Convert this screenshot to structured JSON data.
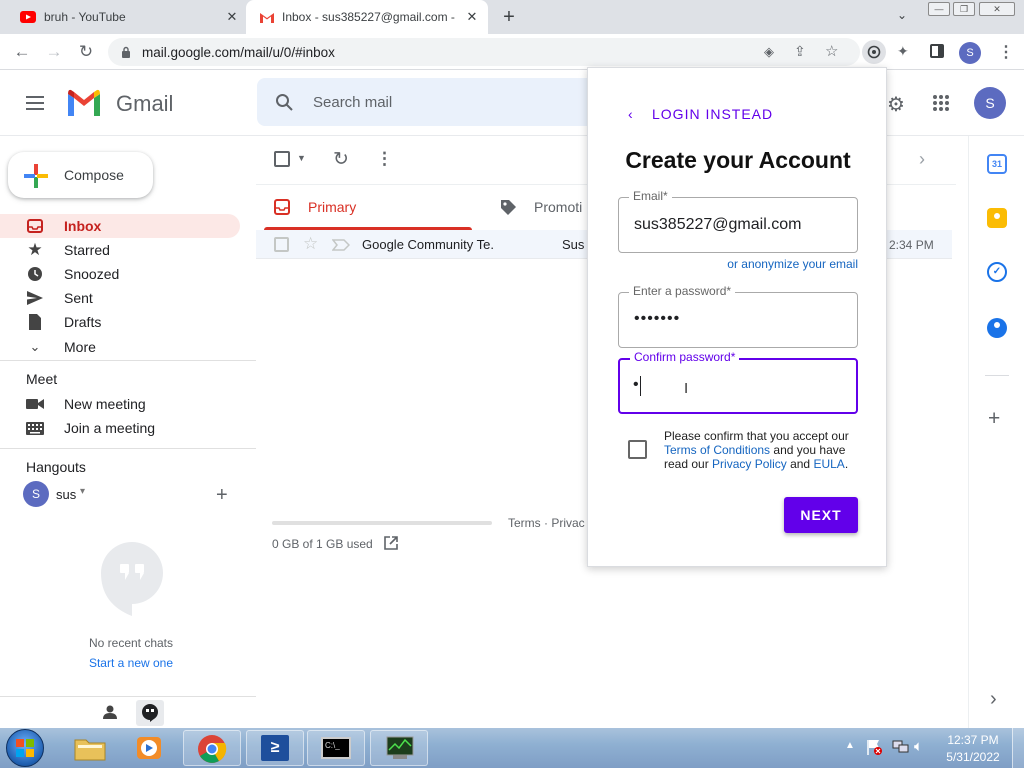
{
  "browser": {
    "tabs": [
      {
        "label": "bruh - YouTube"
      },
      {
        "label": "Inbox - sus385227@gmail.com -"
      }
    ],
    "url": "mail.google.com/mail/u/0/#inbox",
    "profile_initial": "S"
  },
  "gmail": {
    "logo_text": "Gmail",
    "search_placeholder": "Search mail",
    "account_initial": "S",
    "compose_label": "Compose",
    "nav": [
      "Inbox",
      "Starred",
      "Snoozed",
      "Sent",
      "Drafts",
      "More"
    ],
    "meet": {
      "title": "Meet",
      "items": [
        "New meeting",
        "Join a meeting"
      ]
    },
    "hangouts": {
      "title": "Hangouts",
      "user_initial": "S",
      "user_name": "sus",
      "no_chats": "No recent chats",
      "start_new": "Start a new one"
    },
    "tabs": {
      "primary": "Primary",
      "promotions": "Promoti"
    },
    "emails": [
      {
        "sender": "Google Community Te.",
        "subject": "Sus",
        "time": "2:34 PM"
      }
    ],
    "storage": "0 GB of 1 GB used",
    "footer_links": "Terms · Privac"
  },
  "popup": {
    "back_label": "LOGIN INSTEAD",
    "title": "Create your Account",
    "email_label": "Email*",
    "email_value": "sus385227@gmail.com",
    "anonymize_link": "or anonymize your email",
    "password_label": "Enter a password*",
    "password_value": "•••••••",
    "confirm_label": "Confirm password*",
    "confirm_value": "•",
    "terms_pre": "Please confirm that you accept our",
    "terms_link": "Terms of Conditions",
    "terms_mid": "and you have read our",
    "privacy_link": "Privacy Policy",
    "and_text": "and",
    "eula_link": "EULA",
    "period": ".",
    "next_label": "NEXT",
    "accent": "#6200ea"
  },
  "taskbar": {
    "time": "12:37 PM",
    "date": "5/31/2022"
  }
}
